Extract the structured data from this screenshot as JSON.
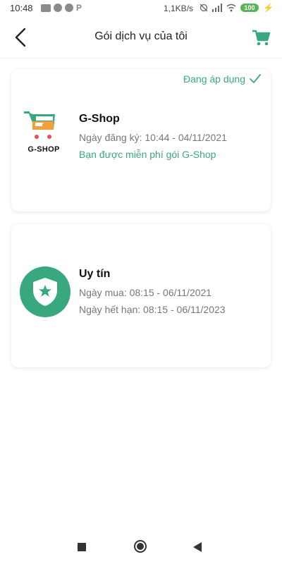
{
  "status_bar": {
    "time": "10:48",
    "network_speed": "1,1KB/s",
    "battery": "100",
    "app_letter": "P"
  },
  "header": {
    "title": "Gói dịch vụ của tôi"
  },
  "colors": {
    "accent": "#3aa87f"
  },
  "packages": [
    {
      "badge": "Đang áp dụng",
      "logo_text": "G-SHOP",
      "name": "G-Shop",
      "line1": "Ngày đăng ký: 10:44 - 04/11/2021",
      "line2": "Bạn được miễn phí gói G-Shop"
    },
    {
      "name": "Uy tín",
      "line1": "Ngày mua: 08:15 - 06/11/2021",
      "line2": "Ngày hết hạn: 08:15 - 06/11/2023"
    }
  ]
}
